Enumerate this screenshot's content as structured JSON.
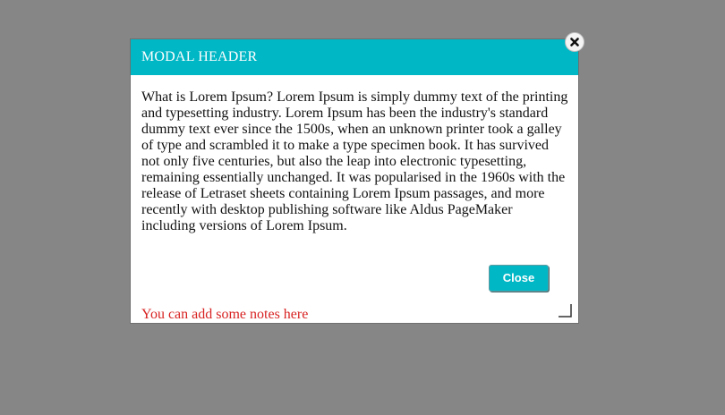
{
  "modal": {
    "header_title": "MODAL HEADER",
    "body_text": "What is Lorem Ipsum? Lorem Ipsum is simply dummy text of the printing and typesetting industry. Lorem Ipsum has been the industry's standard dummy text ever since the 1500s, when an unknown printer took a galley of type and scrambled it to make a type specimen book. It has survived not only five centuries, but also the leap into electronic typesetting, remaining essentially unchanged. It was popularised in the 1960s with the release of Letraset sheets containing Lorem Ipsum passages, and more recently with desktop publishing software like Aldus PageMaker including versions of Lorem Ipsum.",
    "close_button_label": "Close",
    "notes_text": "You can add some notes here"
  },
  "colors": {
    "overlay": "#868686",
    "header_accent": "#00b7c6",
    "notes": "#d82222"
  },
  "icons": {
    "close": "close-icon",
    "resize": "resize-handle-icon"
  }
}
